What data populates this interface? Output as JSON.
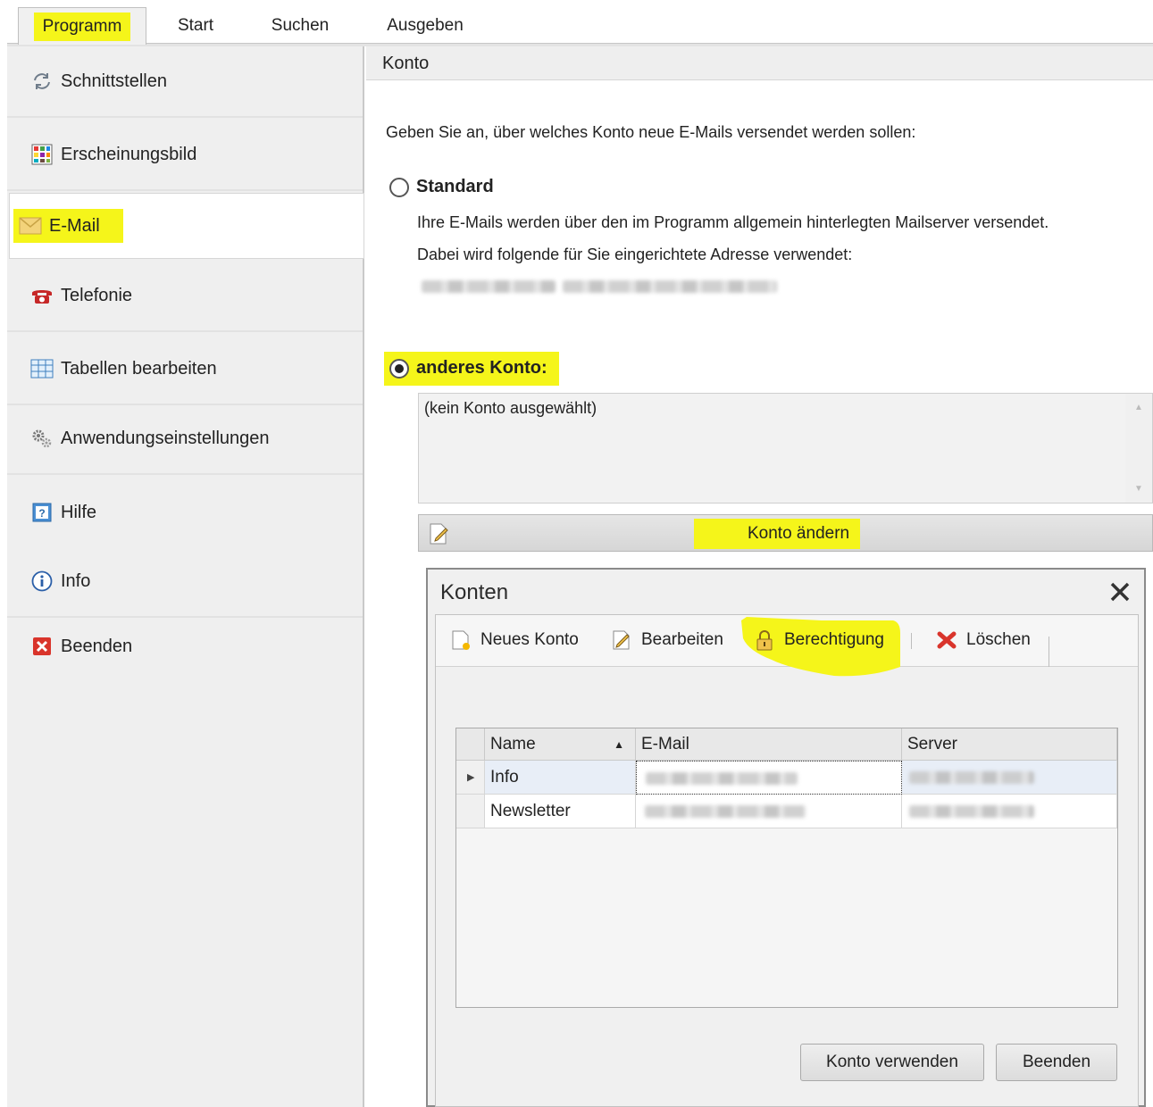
{
  "tabs": [
    "Programm",
    "Start",
    "Suchen",
    "Ausgeben"
  ],
  "sidebar": {
    "items": [
      {
        "label": "Schnittstellen",
        "icon": "sync-icon"
      },
      {
        "label": "Erscheinungsbild",
        "icon": "palette-icon"
      },
      {
        "label": "E-Mail",
        "icon": "envelope-icon",
        "selected": true
      },
      {
        "label": "Telefonie",
        "icon": "phone-icon"
      },
      {
        "label": "Tabellen bearbeiten",
        "icon": "table-icon"
      },
      {
        "label": "Anwendungseinstellungen",
        "icon": "gears-icon"
      },
      {
        "label": "Hilfe",
        "icon": "help-icon"
      },
      {
        "label": "Info",
        "icon": "info-icon"
      },
      {
        "label": "Beenden",
        "icon": "exit-icon"
      }
    ]
  },
  "panel": {
    "title": "Konto",
    "intro": "Geben Sie an, über welches Konto neue E-Mails versendet werden sollen:",
    "standard": {
      "label": "Standard",
      "line1": "Ihre E-Mails werden über den im Programm allgemein hinterlegten Mailserver versendet.",
      "line2": "Dabei wird folgende für Sie eingerichtete Adresse verwendet:",
      "selected": false
    },
    "other": {
      "label": "anderes Konto:",
      "selected": true,
      "box_text": "(kein Konto ausgewählt)"
    },
    "change_button": "Konto ändern"
  },
  "dialog": {
    "title": "Konten",
    "toolbar": {
      "new": "Neues Konto",
      "edit": "Bearbeiten",
      "permission": "Berechtigung",
      "delete": "Löschen"
    },
    "grid": {
      "columns": [
        "Name",
        "E-Mail",
        "Server"
      ],
      "sort_indicator": "▲",
      "rows": [
        {
          "name": "Info",
          "current": true
        },
        {
          "name": "Newsletter",
          "current": false
        }
      ]
    },
    "buttons": {
      "use": "Konto verwenden",
      "close": "Beenden"
    }
  },
  "colors": {
    "highlight": "#f5f51a",
    "sidebar_bg": "#efefef",
    "accent_red": "#d9342b"
  }
}
